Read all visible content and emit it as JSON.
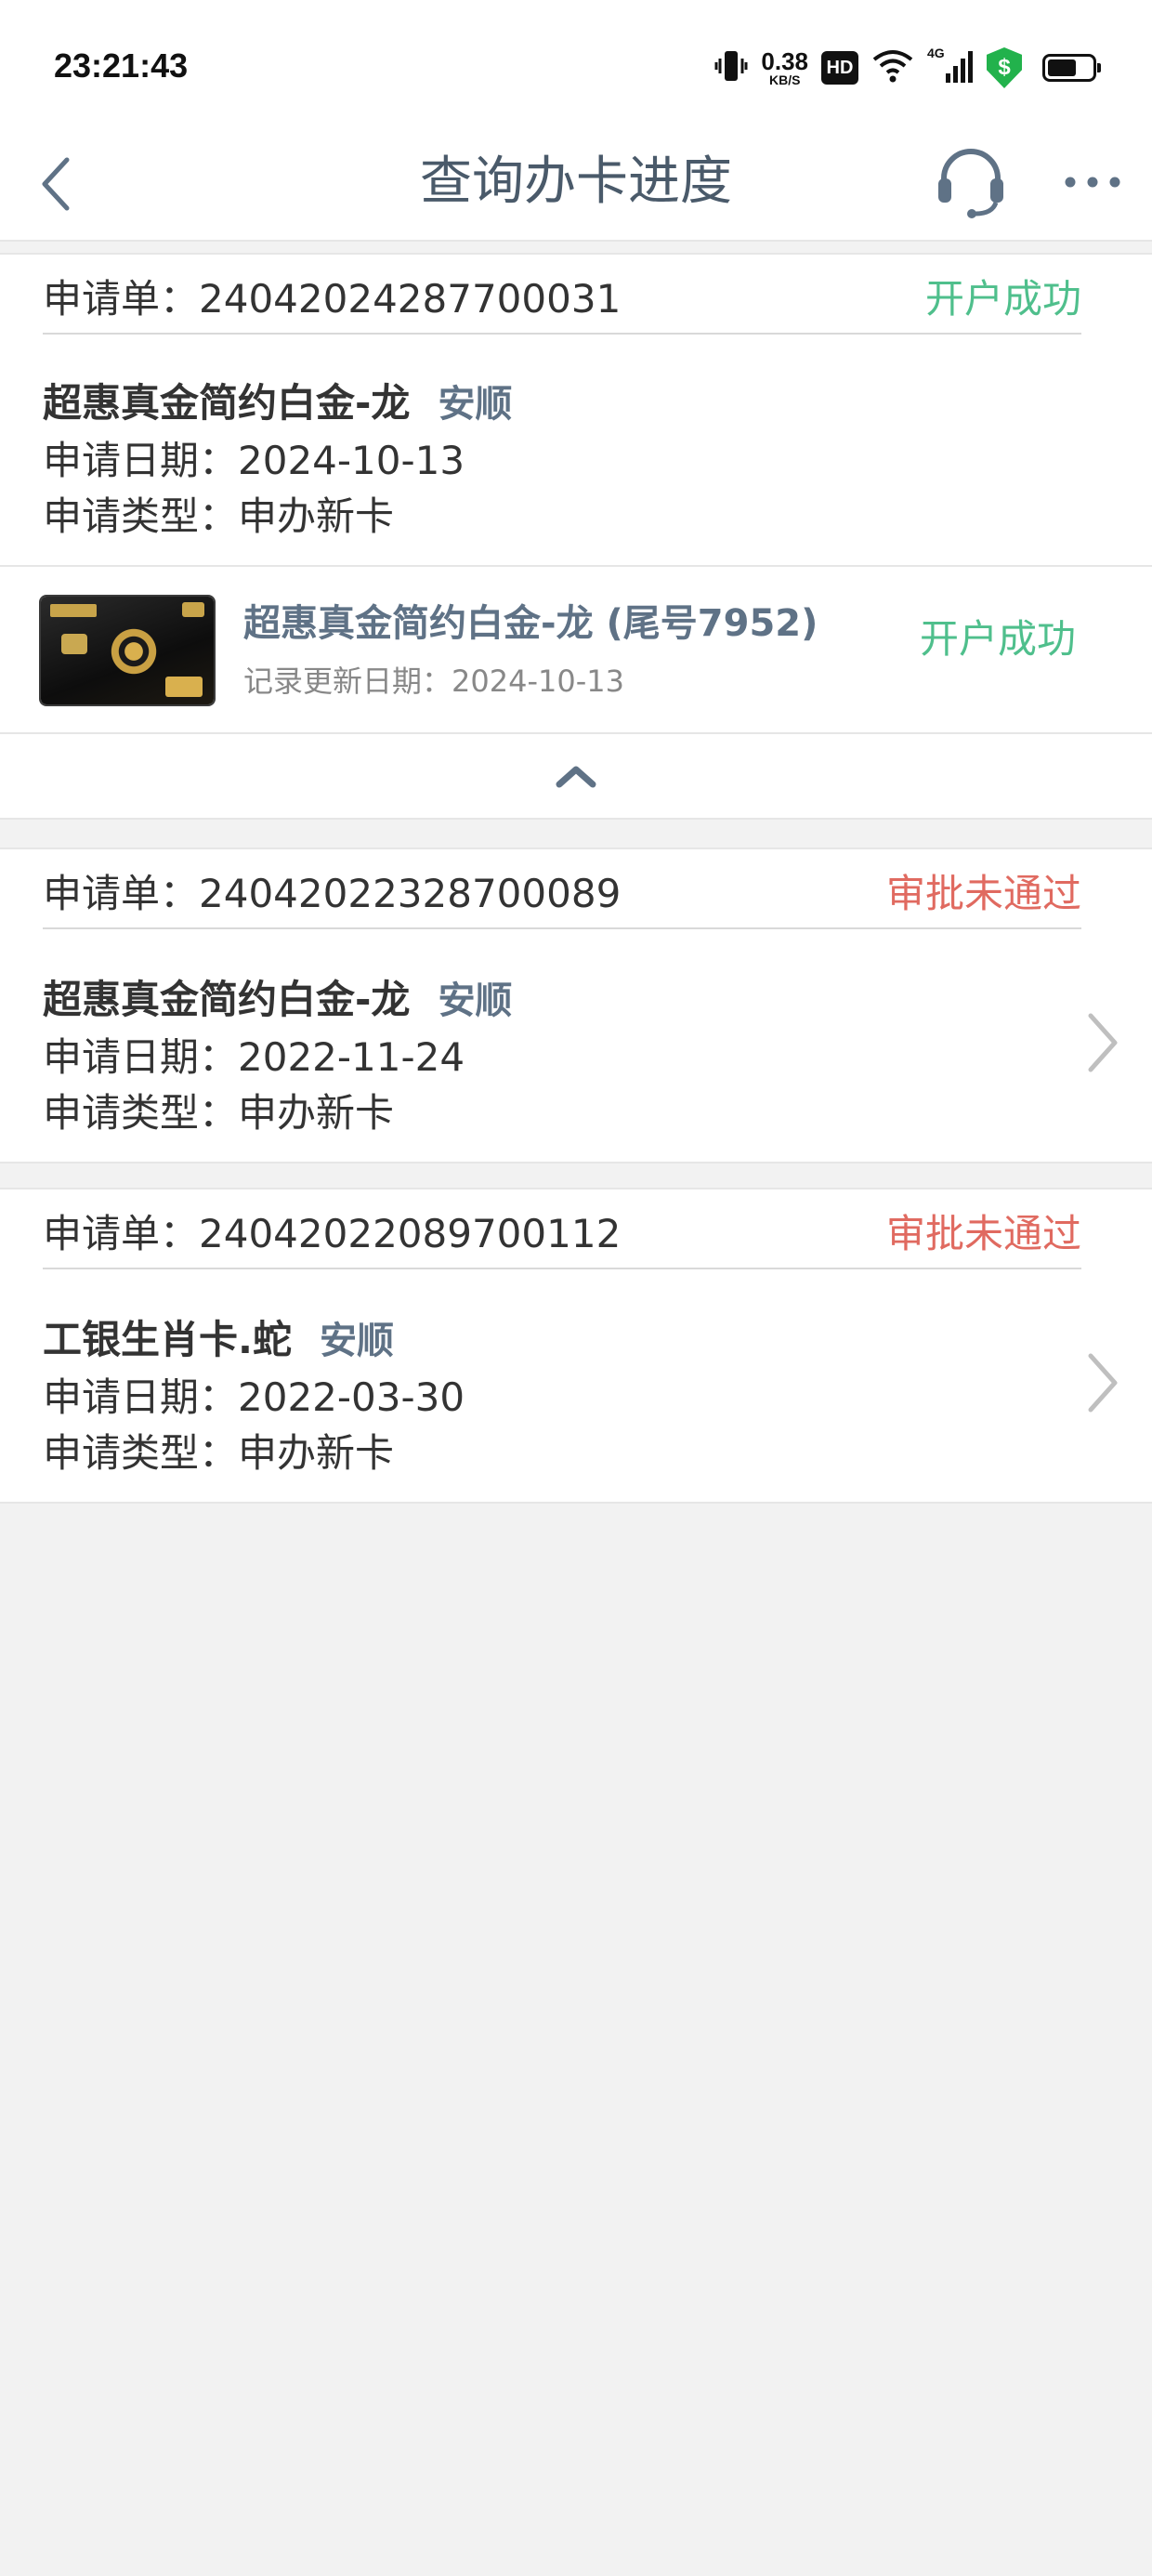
{
  "status_bar": {
    "time": "23:21:43",
    "net_speed_value": "0.38",
    "net_speed_unit": "KB/S",
    "hd_label": "HD",
    "network_label": "4G",
    "battery_level": 0.65
  },
  "nav": {
    "title": "查询办卡进度"
  },
  "applications": [
    {
      "label": "申请单：",
      "number": "24042024287700031",
      "status": "开户成功",
      "card_name": "超惠真金简约白金-龙",
      "holder": "安顺",
      "date_label": "申请日期：",
      "date": "2024-10-13",
      "type_label": "申请类型：",
      "type": "申办新卡"
    },
    {
      "label": "申请单：",
      "number": "24042022328700089",
      "status": "审批未通过",
      "card_name": "超惠真金简约白金-龙",
      "holder": "安顺",
      "date_label": "申请日期：",
      "date": "2022-11-24",
      "type_label": "申请类型：",
      "type": "申办新卡"
    },
    {
      "label": "申请单：",
      "number": "24042022089700112",
      "status": "审批未通过",
      "card_name": "工银生肖卡.蛇",
      "holder": "安顺",
      "date_label": "申请日期：",
      "date": "2022-03-30",
      "type_label": "申请类型：",
      "type": "申办新卡"
    }
  ],
  "issued_card": {
    "name": "超惠真金简约白金-龙 (尾号7952)",
    "update_label": "记录更新日期：",
    "update_date": "2024-10-13",
    "status": "开户成功"
  },
  "icons": {
    "back": "chevron-left-icon",
    "service": "headset-icon",
    "more": "more-icon",
    "collapse": "chevron-up-icon",
    "detail": "chevron-right-icon"
  },
  "colors": {
    "success": "#4fbf8c",
    "fail": "#e06a60",
    "title": "#4a5a6a",
    "holder": "#5f7286"
  }
}
